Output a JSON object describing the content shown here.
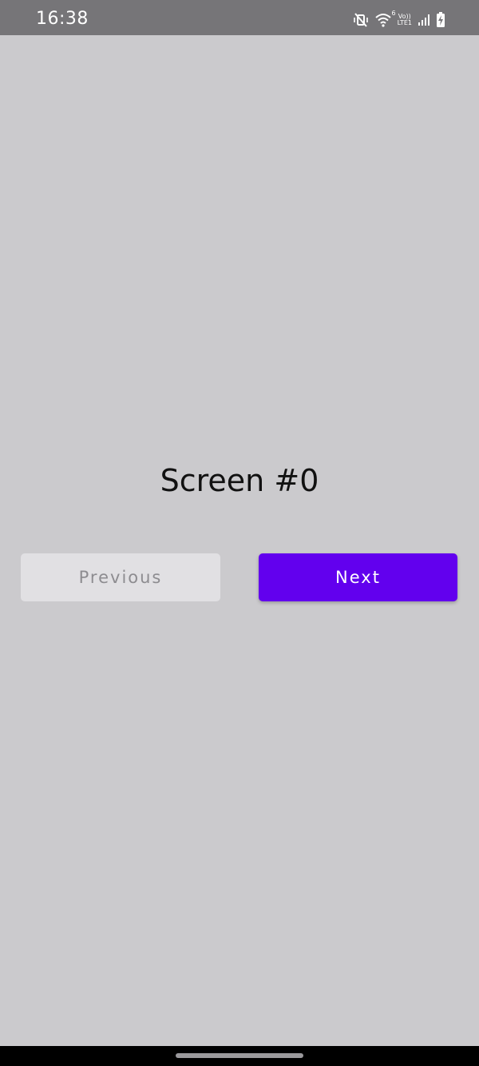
{
  "status_bar": {
    "time": "16:38",
    "network_label_top": "Vo))",
    "network_label_bottom": "LTE1",
    "wifi_badge": "6",
    "icons": [
      "mute-vibrate-icon",
      "wifi-icon",
      "volte-lte-icon",
      "signal-icon",
      "battery-charging-icon"
    ]
  },
  "main": {
    "title": "Screen #0",
    "previous_label": "Previous",
    "next_label": "Next"
  },
  "colors": {
    "background": "#cbcacd",
    "accent": "#6200ee",
    "disabled_button": "#e1e0e3",
    "disabled_text": "#8d8c90"
  }
}
